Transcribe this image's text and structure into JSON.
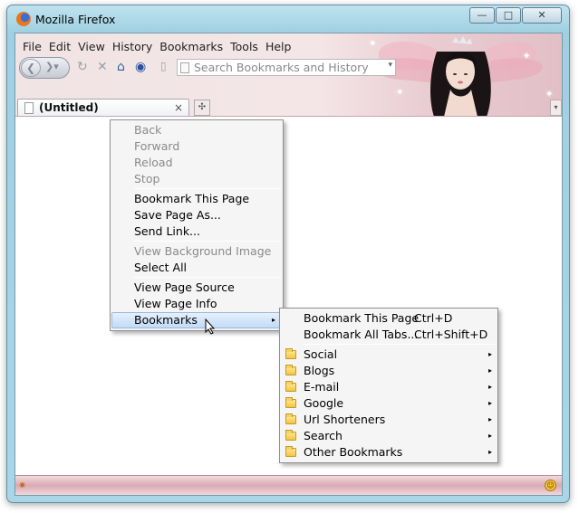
{
  "window": {
    "title": "Mozilla Firefox",
    "buttons": [
      "—",
      "□",
      "✕"
    ]
  },
  "menubar": [
    "File",
    "Edit",
    "View",
    "History",
    "Bookmarks",
    "Tools",
    "Help"
  ],
  "navbar": {
    "search_placeholder": "Search Bookmarks and History"
  },
  "tab": {
    "label": "(Untitled)",
    "close": "×"
  },
  "context_menu": {
    "groups": [
      [
        {
          "label": "Back",
          "disabled": true
        },
        {
          "label": "Forward",
          "disabled": true
        },
        {
          "label": "Reload",
          "disabled": true
        },
        {
          "label": "Stop",
          "disabled": true
        }
      ],
      [
        {
          "label": "Bookmark This Page",
          "disabled": false
        },
        {
          "label": "Save Page As...",
          "disabled": false
        },
        {
          "label": "Send Link...",
          "disabled": false
        }
      ],
      [
        {
          "label": "View Background Image",
          "disabled": true
        },
        {
          "label": "Select All",
          "disabled": false
        }
      ],
      [
        {
          "label": "View Page Source",
          "disabled": false
        },
        {
          "label": "View Page Info",
          "disabled": false
        },
        {
          "label": "Bookmarks",
          "disabled": false,
          "highlighted": true,
          "submenu": true
        }
      ]
    ]
  },
  "bookmarks_submenu": {
    "actions": [
      {
        "label": "Bookmark This Page",
        "shortcut": "Ctrl+D"
      },
      {
        "label": "Bookmark All Tabs...",
        "shortcut": "Ctrl+Shift+D"
      }
    ],
    "folders": [
      "Social",
      "Blogs",
      "E-mail",
      "Google",
      "Url Shorteners",
      "Search",
      "Other Bookmarks"
    ]
  },
  "icons": {
    "app": "firefox-logo-icon",
    "home": "home-icon",
    "folder": "folder-icon",
    "submenu_arrow": "▸"
  }
}
